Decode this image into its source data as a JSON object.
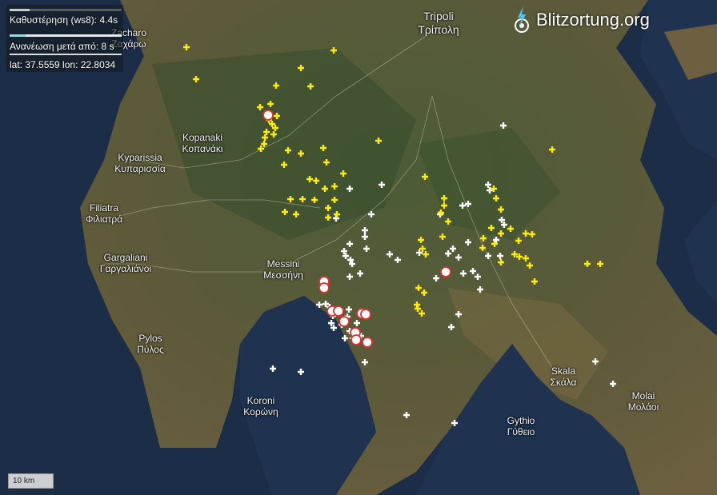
{
  "info": {
    "delay_text": "Καθυστέρηση (ws8): 4.4s",
    "refresh_text": "Ανανέωση μετά από: 8 s",
    "coords_text": "lat: 37.5559 lon: 22.8034",
    "delay_progress": 0.18,
    "refresh_progress": 0.14,
    "refresh_color": "#7fe3ec"
  },
  "brand": {
    "title": "Blitzortung.org",
    "logo_icon": "lightning-bolt-icon"
  },
  "scale": {
    "label": "10 km"
  },
  "places": [
    {
      "id": "tripoli",
      "latin": "Tripoli",
      "greek": "Τρίπολη"
    },
    {
      "id": "zacharo",
      "latin": "Zacharo",
      "greek": "Ζαχάρω"
    },
    {
      "id": "kopanaki",
      "latin": "Kopanaki",
      "greek": "Κοπανάκι"
    },
    {
      "id": "kyparissia",
      "latin": "Kyparissia",
      "greek": "Κυπαρισσία"
    },
    {
      "id": "filiatra",
      "latin": "Filiatra",
      "greek": "Φιλιατρά"
    },
    {
      "id": "gargaliani",
      "latin": "Gargaliani",
      "greek": "Γαργαλιάνοι"
    },
    {
      "id": "messini",
      "latin": "Messini",
      "greek": "Μεσσήνη"
    },
    {
      "id": "pylos",
      "latin": "Pylos",
      "greek": "Πύλος"
    },
    {
      "id": "koroni",
      "latin": "Koroni",
      "greek": "Κορώνη"
    },
    {
      "id": "skala",
      "latin": "Skala",
      "greek": "Σκάλα"
    },
    {
      "id": "molai",
      "latin": "Molai",
      "greek": "Μολάοι"
    },
    {
      "id": "gythio",
      "latin": "Gythio",
      "greek": "Γύθειο"
    }
  ],
  "colors": {
    "recent_strike": "#ffee00",
    "older_strike": "#ffffff",
    "latest_strike_ring": "#e03030",
    "sea": "#1f3350",
    "land": "#4a5a38"
  }
}
